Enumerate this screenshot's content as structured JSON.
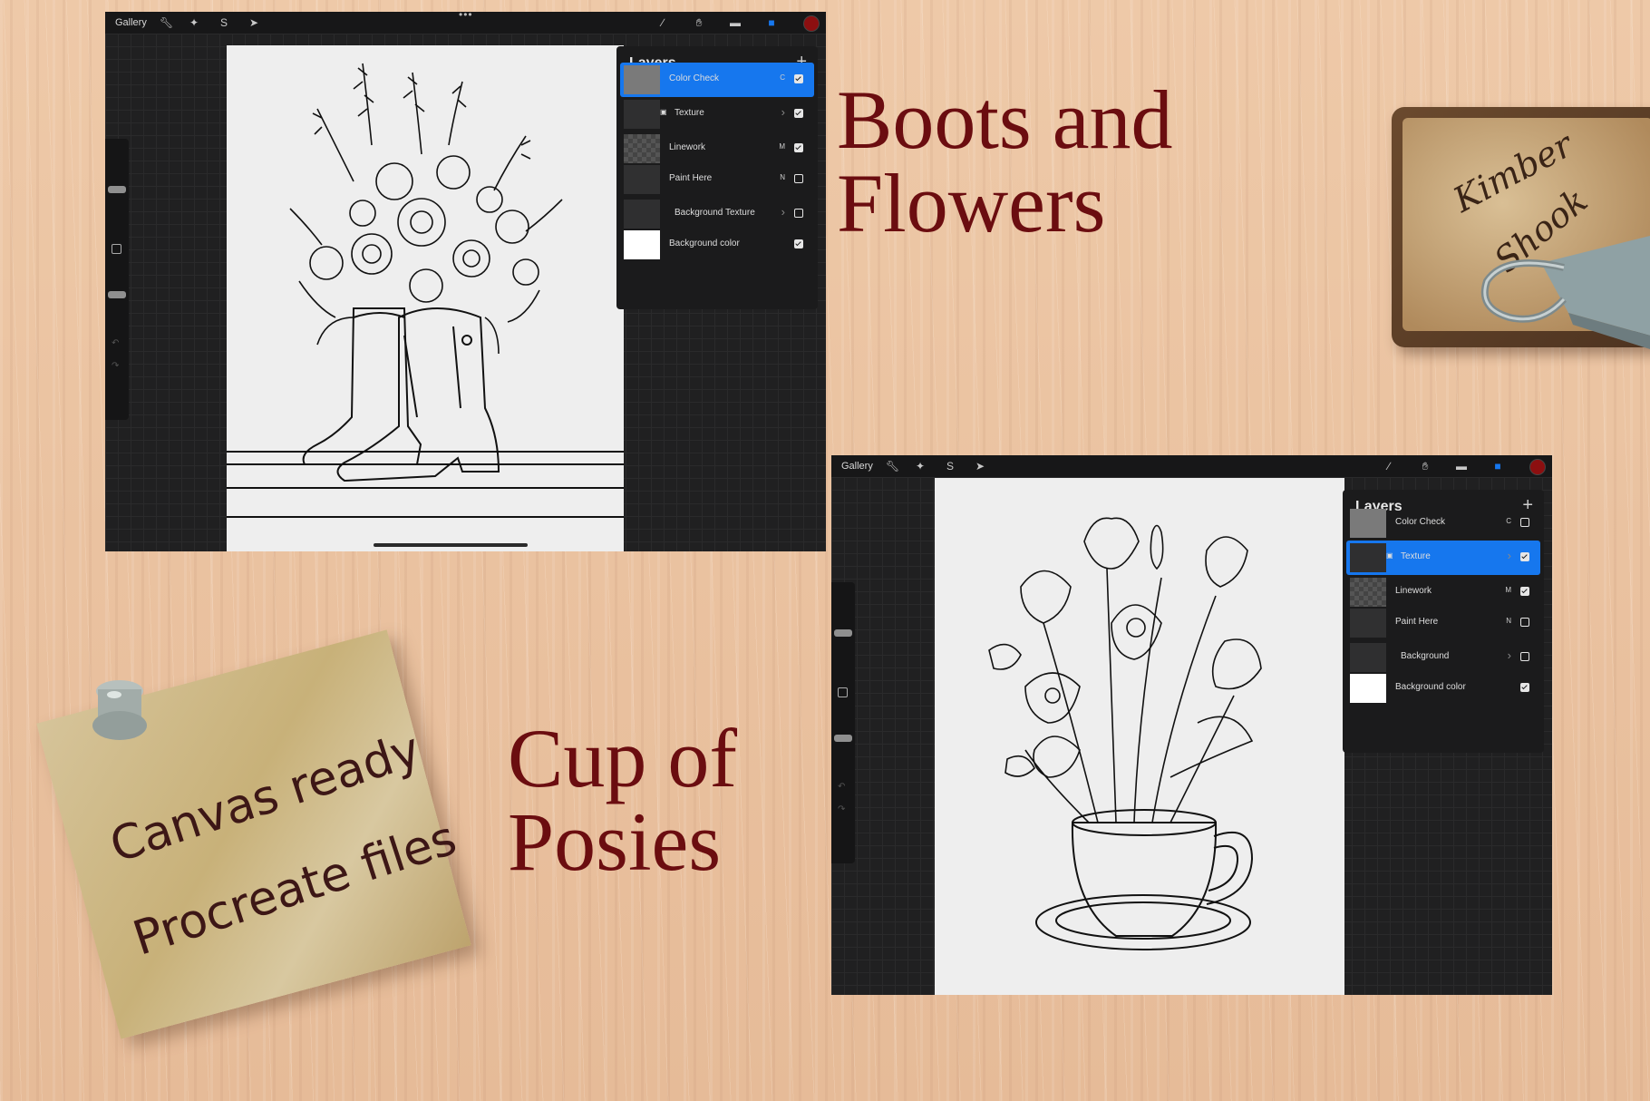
{
  "window1": {
    "gallery_label": "Gallery",
    "layers_title": "Layers",
    "layers": [
      {
        "name": "Color Check",
        "mode": "C",
        "visible": true,
        "active": true,
        "thumb": "gray"
      },
      {
        "name": "Texture",
        "mode": "",
        "visible": true,
        "active": false,
        "thumb": "group",
        "group": true,
        "locked": true
      },
      {
        "name": "Linework",
        "mode": "M",
        "visible": true,
        "active": false,
        "thumb": "checker"
      },
      {
        "name": "Paint Here",
        "mode": "N",
        "visible": false,
        "active": false,
        "thumb": "dark"
      },
      {
        "name": "Background Texture",
        "mode": "",
        "visible": false,
        "active": false,
        "thumb": "group",
        "group": true
      },
      {
        "name": "Background color",
        "mode": "",
        "visible": true,
        "active": false,
        "thumb": "white"
      }
    ]
  },
  "window2": {
    "gallery_label": "Gallery",
    "layers_title": "Layers",
    "layers": [
      {
        "name": "Color Check",
        "mode": "C",
        "visible": false,
        "active": false,
        "thumb": "gray"
      },
      {
        "name": "Texture",
        "mode": "",
        "visible": true,
        "active": true,
        "thumb": "group",
        "group": true,
        "locked": true
      },
      {
        "name": "Linework",
        "mode": "M",
        "visible": true,
        "active": false,
        "thumb": "checker"
      },
      {
        "name": "Paint Here",
        "mode": "N",
        "visible": false,
        "active": false,
        "thumb": "dark"
      },
      {
        "name": "Background",
        "mode": "",
        "visible": false,
        "active": false,
        "thumb": "group",
        "group": true
      },
      {
        "name": "Background color",
        "mode": "",
        "visible": true,
        "active": false,
        "thumb": "white"
      }
    ]
  },
  "titles": {
    "boots_line1": "Boots and",
    "boots_line2": "Flowers",
    "cup_line1": "Cup of",
    "cup_line2": "Posies"
  },
  "note": {
    "line1": "Canvas ready",
    "line2": "Procreate files"
  },
  "plaque": {
    "line1": "Kimber",
    "line2": "Shook"
  },
  "colors": {
    "accent_blue": "#1677ee",
    "title_red": "#6b0d10",
    "brush_color": "#8c0f10"
  },
  "toolbar_icons": [
    "wrench-icon",
    "magic-wand-icon",
    "selection-icon",
    "move-arrow-icon",
    "brush-icon",
    "smudge-icon",
    "eraser-icon",
    "layers-icon",
    "color-icon"
  ]
}
